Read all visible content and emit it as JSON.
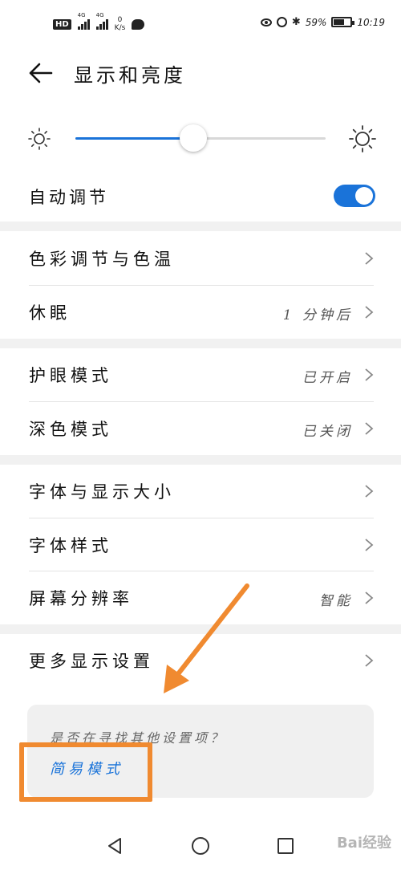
{
  "status_bar": {
    "hd_badge": "HD",
    "sim1_label": "4G",
    "sim2_label": "4G",
    "speed_value": "0",
    "speed_unit": "K/s",
    "battery": "59%",
    "time": "10:19"
  },
  "header": {
    "title": "显示和亮度"
  },
  "brightness": {
    "level": 0.47
  },
  "auto_adjust": {
    "label": "自动调节",
    "enabled": true
  },
  "settings": [
    {
      "label": "色彩调节与色温",
      "value": ""
    },
    {
      "label": "休眠",
      "value": "1 分钟后"
    },
    {
      "label": "护眼模式",
      "value": "已开启"
    },
    {
      "label": "深色模式",
      "value": "已关闭"
    },
    {
      "label": "字体与显示大小",
      "value": ""
    },
    {
      "label": "字体样式",
      "value": ""
    },
    {
      "label": "屏幕分辨率",
      "value": "智能"
    },
    {
      "label": "更多显示设置",
      "value": ""
    }
  ],
  "suggestion": {
    "question": "是否在寻找其他设置项？",
    "link": "简易模式"
  },
  "colors": {
    "accent": "#1a73d9",
    "annotation": "#f08a30",
    "separator": "#f1f1f1"
  },
  "watermark": "Bai经验"
}
